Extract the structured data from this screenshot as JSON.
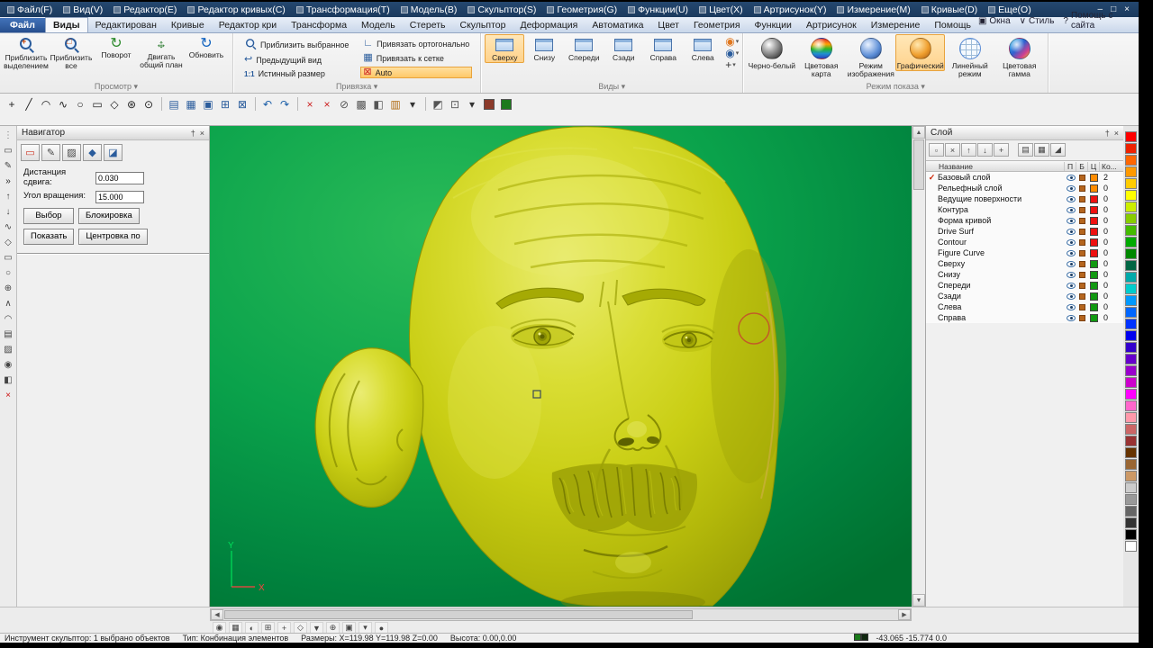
{
  "window": {
    "controls": [
      {
        "name": "minimize-button",
        "glyph": "–"
      },
      {
        "name": "maximize-button",
        "glyph": "□"
      },
      {
        "name": "close-button",
        "glyph": "×"
      }
    ]
  },
  "menubar": {
    "items": [
      "Файл(F)",
      "Вид(V)",
      "Редактор(E)",
      "Редактор кривых(C)",
      "Трансформация(T)",
      "Модель(B)",
      "Скульптор(S)",
      "Геометрия(G)",
      "Функции(U)",
      "Цвет(X)",
      "Артрисунок(Y)",
      "Измерение(M)",
      "Кривые(D)",
      "Еще(O)"
    ]
  },
  "tabbar": {
    "tabs": [
      {
        "label": "Файл",
        "style": "file"
      },
      {
        "label": "Виды",
        "active": true
      },
      {
        "label": "Редактирован"
      },
      {
        "label": "Кривые"
      },
      {
        "label": "Редактор кри"
      },
      {
        "label": "Трансформа"
      },
      {
        "label": "Модель"
      },
      {
        "label": "Стереть"
      },
      {
        "label": "Скульптор"
      },
      {
        "label": "Деформация"
      },
      {
        "label": "Автоматика"
      },
      {
        "label": "Цвет"
      },
      {
        "label": "Геометрия"
      },
      {
        "label": "Функции"
      },
      {
        "label": "Артрисунок"
      },
      {
        "label": "Измерение"
      },
      {
        "label": "Помощь"
      }
    ],
    "right": [
      {
        "name": "windows-menu",
        "icon": "▣",
        "label": "Окна"
      },
      {
        "name": "style-menu",
        "icon": "∨",
        "label": "Стиль"
      },
      {
        "name": "site-help-link",
        "icon": "?",
        "label": "Помощь с сайта"
      }
    ]
  },
  "ribbon": {
    "groups": [
      {
        "id": "prosmotr",
        "name": "Просмотр",
        "btn_class": "rb-big",
        "buttons": [
          {
            "name": "zoom-selection-button",
            "icon": "zoom-select",
            "label": "Приблизить выделением"
          },
          {
            "name": "zoom-all-button",
            "icon": "zoom-all",
            "label": "Приблизить все"
          },
          {
            "name": "rotate-view-button",
            "icon": "rotate",
            "label": "Поворот"
          },
          {
            "name": "pan-view-button",
            "icon": "pan",
            "label": "Двигать общий план"
          },
          {
            "name": "refresh-view-button",
            "icon": "refresh",
            "label": "Обновить"
          }
        ]
      },
      {
        "id": "privyazka",
        "name": "Привязка",
        "col1": [
          {
            "name": "zoom-selected-button",
            "icon": "zoom-sm",
            "label": "Приблизить выбранное"
          },
          {
            "name": "previous-view-button",
            "icon": "prev",
            "label": "Предыдущий вид"
          },
          {
            "name": "true-size-button",
            "icon": "truesize",
            "label": "Истинный размер"
          }
        ],
        "col2": [
          {
            "name": "snap-ortho-button",
            "icon": "ortho",
            "label": "Привязать ортогонально"
          },
          {
            "name": "snap-grid-button",
            "icon": "grid",
            "label": "Привязать к сетке"
          },
          {
            "name": "snap-auto-button",
            "icon": "auto",
            "label": "Auto",
            "active": true
          }
        ]
      },
      {
        "id": "vidy",
        "name": "Виды",
        "btn_class": "rb-view",
        "buttons": [
          {
            "name": "view-top-button",
            "icon": "cube",
            "label": "Сверху",
            "active": true
          },
          {
            "name": "view-bottom-button",
            "icon": "cube",
            "label": "Снизу"
          },
          {
            "name": "view-front-button",
            "icon": "cube",
            "label": "Спереди"
          },
          {
            "name": "view-back-button",
            "icon": "cube",
            "label": "Сзади"
          },
          {
            "name": "view-right-button",
            "icon": "cube",
            "label": "Справа"
          },
          {
            "name": "view-left-button",
            "icon": "cube",
            "label": "Слева"
          }
        ],
        "extra": [
          {
            "name": "orbit-orange-button",
            "icon": "orb-o"
          },
          {
            "name": "orbit-blue-button",
            "icon": "orb-b"
          },
          {
            "name": "axis-view-button",
            "icon": "axis"
          }
        ]
      },
      {
        "id": "rezhim",
        "name": "Режим показа",
        "btn_class": "rb-disp",
        "buttons": [
          {
            "name": "display-blackwhite-button",
            "icon": "sph-bw",
            "label": "Черно-белый"
          },
          {
            "name": "display-colormap-button",
            "icon": "sph-map",
            "label": "Цветовая карта"
          },
          {
            "name": "display-image-button",
            "icon": "sph-image",
            "label": "Режим изображения"
          },
          {
            "name": "display-graphic-button",
            "icon": "sph-graphic",
            "label": "Графический",
            "active": true
          },
          {
            "name": "display-wireframe-button",
            "icon": "sph-wire",
            "label": "Линейный режим"
          },
          {
            "name": "display-gamma-button",
            "icon": "sph-gamma",
            "label": "Цветовая гамма"
          }
        ]
      }
    ]
  },
  "toolbar": {
    "icons": [
      {
        "name": "draw-point-icon",
        "glyph": "+",
        "color": "#222222"
      },
      {
        "name": "draw-line-icon",
        "glyph": "╱",
        "color": "#222222"
      },
      {
        "name": "draw-arc-icon",
        "glyph": "◠",
        "color": "#222222"
      },
      {
        "name": "draw-curve-icon",
        "glyph": "∿",
        "color": "#222222"
      },
      {
        "name": "draw-circle-icon",
        "glyph": "○",
        "color": "#222222"
      },
      {
        "name": "draw-rect-icon",
        "glyph": "▭",
        "color": "#222222"
      },
      {
        "name": "draw-polygon-icon",
        "glyph": "◇",
        "color": "#222222"
      },
      {
        "name": "draw-star-icon",
        "glyph": "⊛",
        "color": "#222222"
      },
      {
        "name": "draw-target-icon",
        "glyph": "⊙",
        "color": "#222222"
      },
      {
        "sep": true
      },
      {
        "name": "new-document-icon",
        "glyph": "▤",
        "color": "#2a5c9c"
      },
      {
        "name": "open-document-icon",
        "glyph": "▦",
        "color": "#2a5c9c"
      },
      {
        "name": "save-document-icon",
        "glyph": "▣",
        "color": "#2a5c9c"
      },
      {
        "name": "grid-icon",
        "glyph": "⊞",
        "color": "#2a5c9c"
      },
      {
        "name": "bounds-icon",
        "glyph": "⊠",
        "color": "#2a5c9c"
      },
      {
        "sep": true
      },
      {
        "name": "undo-icon",
        "glyph": "↶",
        "color": "#1c5fa8"
      },
      {
        "name": "redo-icon",
        "glyph": "↷",
        "color": "#1c5fa8"
      },
      {
        "sep": true
      },
      {
        "name": "delete-icon",
        "glyph": "×",
        "color": "#cc2222"
      },
      {
        "name": "erase-icon",
        "glyph": "×",
        "color": "#cc2222"
      },
      {
        "name": "trim-icon",
        "glyph": "⊘",
        "color": "#555555"
      },
      {
        "name": "hatch-icon",
        "glyph": "▩",
        "color": "#555555"
      },
      {
        "name": "mirror-icon",
        "glyph": "◧",
        "color": "#555555"
      },
      {
        "name": "layers-icon",
        "glyph": "▥",
        "color": "#b06a10"
      },
      {
        "name": "layers-dropdown-icon",
        "glyph": "▾",
        "color": "#333333"
      },
      {
        "sep": true
      },
      {
        "name": "fill-mode-icon",
        "glyph": "◩",
        "color": "#555555"
      },
      {
        "name": "box-mode-icon",
        "glyph": "⊡",
        "color": "#555555"
      },
      {
        "name": "mode-dropdown-icon",
        "glyph": "▾",
        "color": "#333333"
      },
      {
        "name": "primary-color-swatch",
        "swatch": "#8b3a2a"
      },
      {
        "name": "secondary-color-swatch",
        "swatch": "#1d7a1d"
      }
    ]
  },
  "leftstrip": {
    "icons": [
      {
        "name": "dock-handle-icon",
        "glyph": "⋮",
        "color": "#777777"
      },
      {
        "name": "select-rect-icon",
        "glyph": "▭",
        "color": "#444444"
      },
      {
        "name": "edit-pencil-icon",
        "glyph": "✎",
        "color": "#444444"
      },
      {
        "name": "expand-panel-icon",
        "glyph": "»",
        "color": "#222222"
      },
      {
        "name": "sculpt-pull-icon",
        "glyph": "↑",
        "color": "#444444"
      },
      {
        "name": "sculpt-push-icon",
        "glyph": "↓",
        "color": "#444444"
      },
      {
        "name": "sculpt-smooth-icon",
        "glyph": "∿",
        "color": "#444444"
      },
      {
        "name": "sculpt-pinch-icon",
        "glyph": "◇",
        "color": "#444444"
      },
      {
        "name": "sculpt-flatten-icon",
        "glyph": "▭",
        "color": "#444444"
      },
      {
        "name": "sculpt-inflate-icon",
        "glyph": "○",
        "color": "#444444"
      },
      {
        "name": "sculpt-grab-icon",
        "glyph": "⊕",
        "color": "#444444"
      },
      {
        "name": "sculpt-crease-icon",
        "glyph": "∧",
        "color": "#444444"
      },
      {
        "name": "sculpt-scrape-icon",
        "glyph": "◠",
        "color": "#444444"
      },
      {
        "name": "sculpt-layer-icon",
        "glyph": "▤",
        "color": "#444444"
      },
      {
        "name": "sculpt-mask-icon",
        "glyph": "▨",
        "color": "#444444"
      },
      {
        "name": "sculpt-stamp-icon",
        "glyph": "◉",
        "color": "#444444"
      },
      {
        "name": "sculpt-mirror-icon",
        "glyph": "◧",
        "color": "#444444"
      },
      {
        "name": "delete-tool-icon",
        "glyph": "×",
        "color": "#cc1111"
      }
    ]
  },
  "navigator": {
    "title": "Навигатор",
    "header_icons": [
      {
        "name": "pin-panel-icon",
        "glyph": "†"
      },
      {
        "name": "close-panel-icon",
        "glyph": "×"
      }
    ],
    "tools": [
      {
        "name": "nav-select-icon",
        "glyph": "▭",
        "color": "#cc3322"
      },
      {
        "name": "nav-edit-icon",
        "glyph": "✎",
        "color": "#444444"
      },
      {
        "name": "nav-hatch-icon",
        "glyph": "▨",
        "color": "#444444"
      },
      {
        "name": "nav-diamond-icon",
        "glyph": "◆",
        "color": "#2a5c9c"
      },
      {
        "name": "nav-brush-icon",
        "glyph": "◪",
        "color": "#2a5c9c"
      }
    ],
    "fields": [
      {
        "name": "shift-distance-field",
        "label": "Дистанция сдвига:",
        "value": "0.030"
      },
      {
        "name": "rotation-angle-field",
        "label": "Угол вращения:",
        "value": "15.000"
      }
    ],
    "buttons": [
      {
        "name": "select-button",
        "label": "Выбор"
      },
      {
        "name": "lock-button",
        "label": "Блокировка"
      },
      {
        "name": "show-button",
        "label": "Показать"
      },
      {
        "name": "centering-button",
        "label": "Центровка по"
      }
    ]
  },
  "viewport": {
    "axis": {
      "x": "X",
      "y": "Y"
    },
    "background_color": "#00a148",
    "model_color": "#c9ce14",
    "selection_ring_color": "#c25b28"
  },
  "layer_panel": {
    "title": "Слой",
    "header_icons": [
      {
        "name": "pin-panel-icon",
        "glyph": "†"
      },
      {
        "name": "close-panel-icon",
        "glyph": "×"
      }
    ],
    "tools": [
      {
        "name": "new-layer-icon",
        "glyph": "▫"
      },
      {
        "name": "delete-layer-icon",
        "glyph": "×"
      },
      {
        "name": "raise-layer-icon",
        "glyph": "↑"
      },
      {
        "name": "lower-layer-icon",
        "glyph": "↓"
      },
      {
        "name": "add-layer-icon",
        "glyph": "+"
      },
      {
        "gap": true
      },
      {
        "name": "list-view-icon",
        "glyph": "▤"
      },
      {
        "name": "detail-view-icon",
        "glyph": "▦"
      },
      {
        "name": "sort-layers-icon",
        "glyph": "◢"
      }
    ],
    "columns": [
      "Название",
      "П",
      "Б",
      "Ц",
      "Ко..."
    ],
    "rows": [
      {
        "name": "Базовый слой",
        "current": true,
        "chip": "#ff8c00",
        "count": "2"
      },
      {
        "name": "Рельефный слой",
        "chip": "#ff8c00",
        "count": "0"
      },
      {
        "name": "Ведущие поверхности",
        "chip": "#ee1111",
        "count": "0"
      },
      {
        "name": "Контура",
        "chip": "#ee1111",
        "count": "0"
      },
      {
        "name": "Форма кривой",
        "chip": "#ee1111",
        "count": "0"
      },
      {
        "name": "Drive Surf",
        "chip": "#ee1111",
        "count": "0"
      },
      {
        "name": "Contour",
        "chip": "#ee1111",
        "count": "0"
      },
      {
        "name": "Figure Curve",
        "chip": "#ee1111",
        "count": "0"
      },
      {
        "name": "Сверху",
        "chip": "#119911",
        "count": "0"
      },
      {
        "name": "Снизу",
        "chip": "#119911",
        "count": "0"
      },
      {
        "name": "Спереди",
        "chip": "#119911",
        "count": "0"
      },
      {
        "name": "Сзади",
        "chip": "#119911",
        "count": "0"
      },
      {
        "name": "Слева",
        "chip": "#119911",
        "count": "0"
      },
      {
        "name": "Справа",
        "chip": "#119911",
        "count": "0"
      }
    ]
  },
  "palette": {
    "colors": [
      "#ff0000",
      "#ee2200",
      "#ff6600",
      "#ff9900",
      "#ffcc00",
      "#ffff00",
      "#ccee00",
      "#88cc00",
      "#44bb00",
      "#00aa00",
      "#008800",
      "#006644",
      "#00aaaa",
      "#00cccc",
      "#0099ff",
      "#0066ff",
      "#0033ff",
      "#0000ee",
      "#3300cc",
      "#6600cc",
      "#9900cc",
      "#cc00cc",
      "#ff00ff",
      "#ff66cc",
      "#ff99aa",
      "#cc6666",
      "#993333",
      "#663300",
      "#996633",
      "#cc9966",
      "#cccccc",
      "#999999",
      "#666666",
      "#333333",
      "#000000",
      "#ffffff"
    ]
  },
  "bottombar": {
    "icons": [
      {
        "name": "render-mode-icon",
        "glyph": "◉"
      },
      {
        "name": "wireframe-toggle-icon",
        "glyph": "▦"
      },
      {
        "name": "shade-toggle-icon",
        "glyph": "◐"
      },
      {
        "name": "grid-toggle-icon",
        "glyph": "⊞"
      },
      {
        "name": "axis-toggle-icon",
        "glyph": "+"
      },
      {
        "name": "snap-toggle-icon",
        "glyph": "◇"
      },
      {
        "name": "view-dropdown-icon",
        "glyph": "▼"
      },
      {
        "name": "target-icon",
        "glyph": "⊕"
      },
      {
        "name": "box-display-icon",
        "glyph": "▣"
      },
      {
        "name": "more-options-icon",
        "glyph": "▾"
      },
      {
        "name": "dot-indicator-icon",
        "glyph": "●"
      }
    ]
  },
  "statusbar": {
    "left_segments": [
      "Инструмент скульптор: 1 выбрано объектов",
      "Тип: Конбинация элементов",
      "Размеры: X=119.98  Y=119.98  Z=0.00",
      "Высота: 0.00,0.00"
    ],
    "indicator_colors": [
      "#1a7a1a",
      "#102810"
    ],
    "right": "-43.065   -15.774   0.0"
  }
}
